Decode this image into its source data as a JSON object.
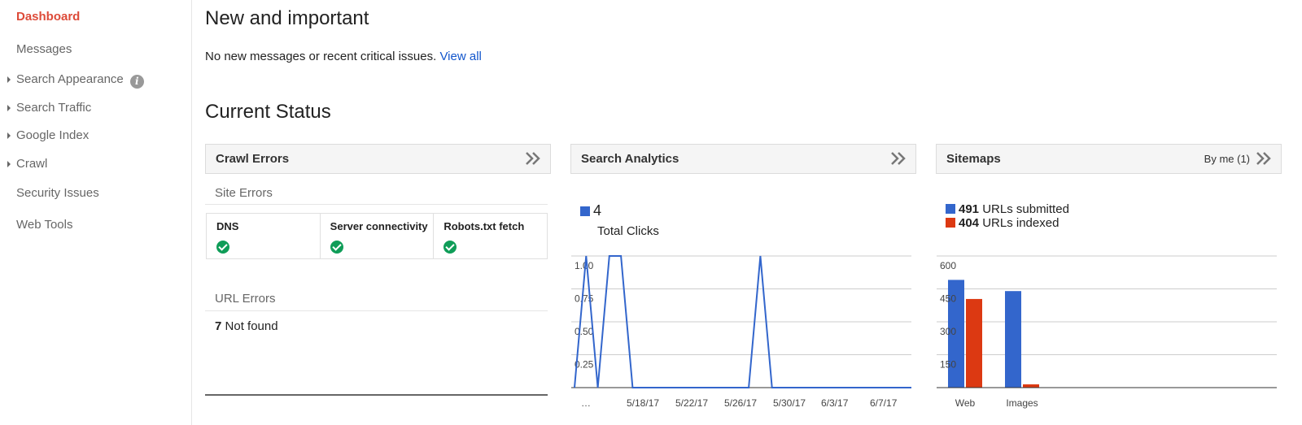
{
  "sidebar": {
    "items": [
      {
        "label": "Dashboard"
      },
      {
        "label": "Messages"
      },
      {
        "label": "Search Appearance"
      },
      {
        "label": "Search Traffic"
      },
      {
        "label": "Google Index"
      },
      {
        "label": "Crawl"
      },
      {
        "label": "Security Issues"
      },
      {
        "label": "Web Tools"
      }
    ],
    "info_glyph": "i"
  },
  "main": {
    "new_title": "New and important",
    "message": "No new messages or recent critical issues.",
    "view_all": "View all",
    "status_title": "Current Status"
  },
  "crawl": {
    "title": "Crawl Errors",
    "site_errors": "Site Errors",
    "cols": [
      "DNS",
      "Server connectivity",
      "Robots.txt fetch"
    ],
    "url_errors": "URL Errors",
    "not_found_count": "7",
    "not_found_label": "Not found"
  },
  "analytics": {
    "title": "Search Analytics",
    "value": "4",
    "caption": "Total Clicks"
  },
  "sitemaps": {
    "title": "Sitemaps",
    "by_me": "By me (1)",
    "submitted_count": "491",
    "submitted_label": "URLs submitted",
    "indexed_count": "404",
    "indexed_label": "URLs indexed"
  },
  "colors": {
    "blue": "#3366cc",
    "red": "#dc3912",
    "accent": "#dd4b39",
    "link": "#1155cc",
    "green": "#0f9d58"
  },
  "chart_data": [
    {
      "type": "line",
      "ylim": [
        0,
        1.0
      ],
      "y_ticks": [
        "0.25",
        "0.50",
        "0.75",
        "1.00"
      ],
      "x_labels": [
        "…",
        "5/18/17",
        "5/22/17",
        "5/26/17",
        "5/30/17",
        "6/3/17",
        "6/7/17"
      ],
      "series": [
        {
          "values": [
            0,
            1,
            0,
            1,
            1,
            0,
            0,
            0,
            0,
            0,
            0,
            0,
            0,
            0,
            0,
            0,
            1,
            0,
            0,
            0,
            0,
            0,
            0,
            0,
            0,
            0,
            0,
            0,
            0,
            0
          ]
        }
      ]
    },
    {
      "type": "bar",
      "categories": [
        "Web",
        "Images"
      ],
      "ylim": [
        0,
        600
      ],
      "y_ticks": [
        "150",
        "300",
        "450",
        "600"
      ],
      "series": [
        {
          "name": "URLs submitted",
          "values": [
            491,
            440
          ]
        },
        {
          "name": "URLs indexed",
          "values": [
            404,
            15
          ]
        }
      ]
    }
  ]
}
